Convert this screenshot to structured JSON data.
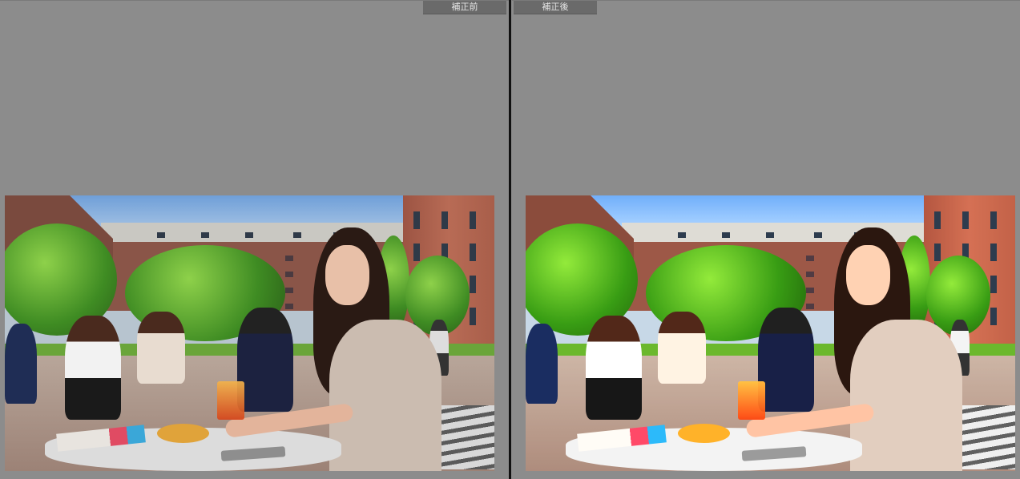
{
  "view": {
    "before_label": "補正前",
    "after_label": "補正後"
  }
}
